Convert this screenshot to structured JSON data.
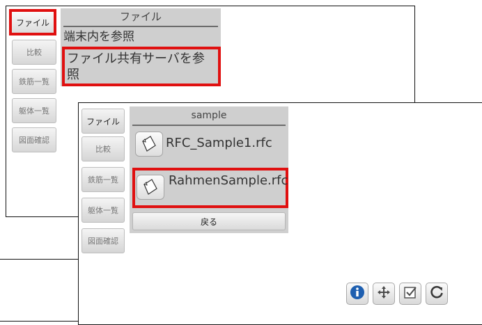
{
  "screen1": {
    "sidebar": {
      "file": "ファイル",
      "compare": "比較",
      "rebar_list": "鉄筋一覧",
      "body_list": "躯体一覧",
      "drawing_check": "図面確認"
    },
    "menu": {
      "title": "ファイル",
      "item_local": "端末内を参照",
      "item_server": "ファイル共有サーバを参照"
    }
  },
  "screen2": {
    "sidebar": {
      "file": "ファイル",
      "compare": "比較",
      "rebar_list": "鉄筋一覧",
      "body_list": "躯体一覧",
      "drawing_check": "図面確認"
    },
    "panel": {
      "title": "sample",
      "files": [
        "RFC_Sample1.rfc",
        "RahmenSample.rfc"
      ],
      "back": "戻る"
    },
    "toolbar": {
      "icons": [
        "info-icon",
        "move-icon",
        "checkbox-icon",
        "refresh-icon"
      ],
      "colors": {
        "info": "#1e5fb0",
        "highlight": "#e01010"
      }
    }
  }
}
